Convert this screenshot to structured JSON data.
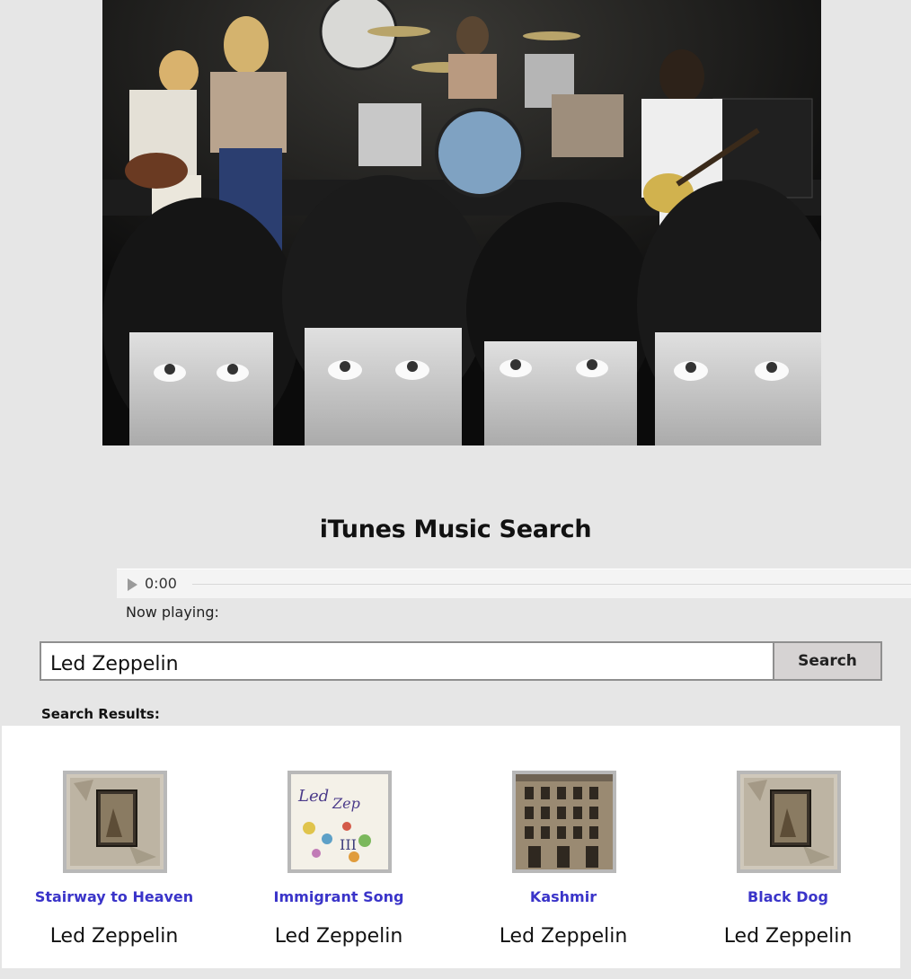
{
  "header": {
    "title": "iTunes Music Search"
  },
  "player": {
    "time": "0:00",
    "now_playing_label": "Now playing:"
  },
  "search": {
    "value": "Led Zeppelin",
    "button_label": "Search"
  },
  "results": {
    "label": "Search Results:",
    "items": [
      {
        "title": "Stairway to Heaven",
        "artist": "Led Zeppelin",
        "cover": "zoso-iv-cover"
      },
      {
        "title": "Immigrant Song",
        "artist": "Led Zeppelin",
        "cover": "led-zeppelin-iii-cover"
      },
      {
        "title": "Kashmir",
        "artist": "Led Zeppelin",
        "cover": "physical-graffiti-cover"
      },
      {
        "title": "Black Dog",
        "artist": "Led Zeppelin",
        "cover": "zoso-iv-cover"
      }
    ]
  },
  "colors": {
    "page_background": "#e6e6e6",
    "link": "#3a34c9",
    "button_background": "#d6d3d3"
  }
}
